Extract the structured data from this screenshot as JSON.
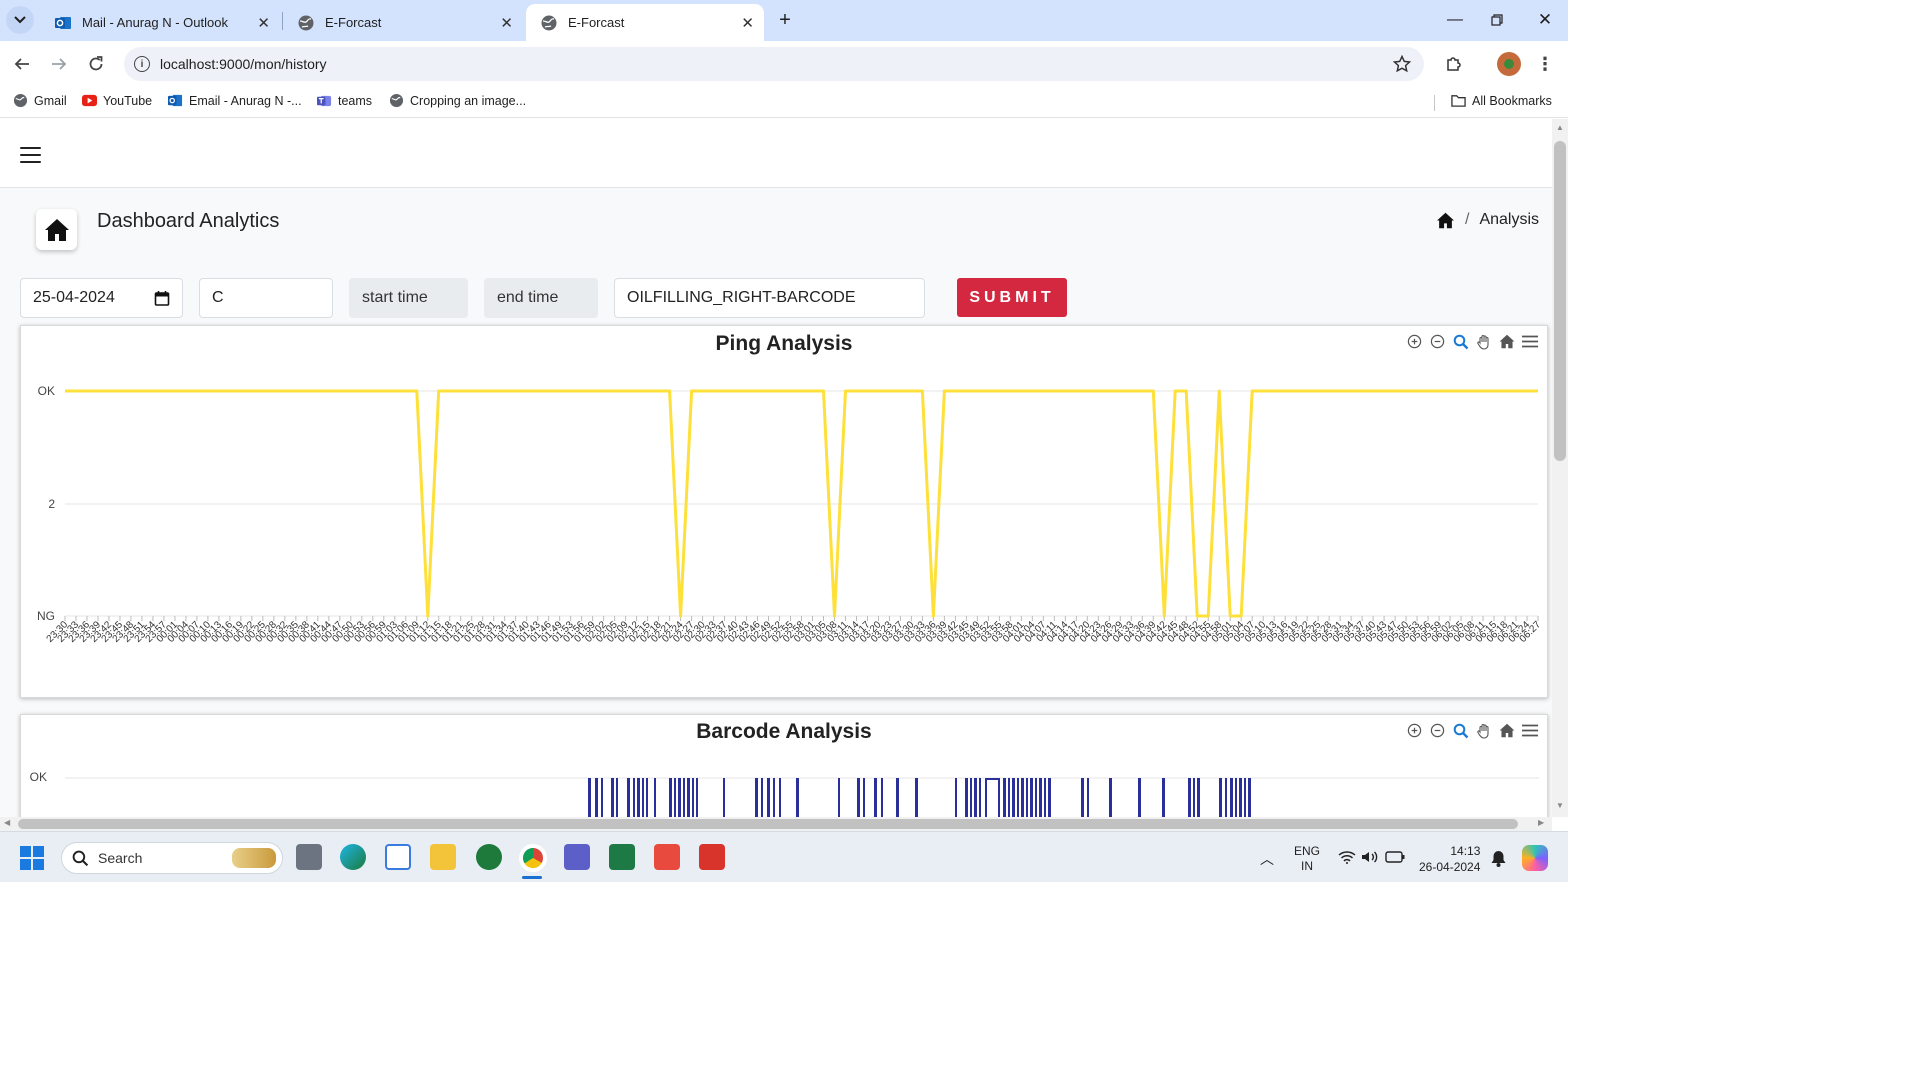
{
  "browser": {
    "tabs": [
      {
        "label": "Mail - Anurag N - Outlook",
        "active": false
      },
      {
        "label": "E-Forcast",
        "active": false
      },
      {
        "label": "E-Forcast",
        "active": true
      }
    ],
    "url": "localhost:9000/mon/history",
    "bookmarks": [
      "Gmail",
      "YouTube",
      "Email - Anurag N -...",
      "teams",
      "Cropping an image..."
    ],
    "all_bookmarks": "All Bookmarks"
  },
  "page": {
    "title": "Dashboard Analytics",
    "breadcrumb": "Analysis",
    "date_value": "25-04-2024",
    "shift_value": "C",
    "start_time_placeholder": "start time",
    "end_time_placeholder": "end time",
    "station_value": "OILFILLING_RIGHT-BARCODE",
    "submit_label": "SUBMIT"
  },
  "chart_data": [
    {
      "type": "line",
      "title": "Ping Analysis",
      "y_ticks": [
        "OK",
        "2",
        "NG"
      ],
      "color": "#fde03a",
      "x": [
        "23:30",
        "23:33",
        "23:36",
        "23:39",
        "23:42",
        "23:45",
        "23:48",
        "23:51",
        "23:54",
        "23:57",
        "00:01",
        "00:04",
        "00:07",
        "00:10",
        "00:13",
        "00:16",
        "00:19",
        "00:22",
        "00:25",
        "00:28",
        "00:32",
        "00:35",
        "00:38",
        "00:41",
        "00:44",
        "00:47",
        "00:50",
        "00:53",
        "00:56",
        "00:59",
        "01:03",
        "01:06",
        "01:09",
        "01:12",
        "01:15",
        "01:18",
        "01:21",
        "01:25",
        "01:28",
        "01:31",
        "01:34",
        "01:37",
        "01:40",
        "01:43",
        "01:46",
        "01:49",
        "01:53",
        "01:56",
        "01:59",
        "02:02",
        "02:05",
        "02:09",
        "02:12",
        "02:15",
        "02:18",
        "02:21",
        "02:24",
        "02:27",
        "02:30",
        "02:33",
        "02:37",
        "02:40",
        "02:43",
        "02:46",
        "02:49",
        "02:52",
        "02:55",
        "02:58",
        "03:01",
        "03:05",
        "03:08",
        "03:11",
        "03:14",
        "03:17",
        "03:20",
        "03:23",
        "03:27",
        "03:30",
        "03:33",
        "03:36",
        "03:39",
        "03:42",
        "03:45",
        "03:49",
        "03:52",
        "03:55",
        "03:58",
        "04:01",
        "04:04",
        "04:07",
        "04:11",
        "04:14",
        "04:17",
        "04:20",
        "04:23",
        "04:26",
        "04:29",
        "04:33",
        "04:36",
        "04:39",
        "04:42",
        "04:45",
        "04:48",
        "04:52",
        "04:55",
        "04:58",
        "05:01",
        "05:04",
        "05:07",
        "05:10",
        "05:13",
        "05:16",
        "05:19",
        "05:22",
        "05:25",
        "05:28",
        "05:31",
        "05:34",
        "05:37",
        "05:40",
        "05:43",
        "05:47",
        "05:50",
        "05:53",
        "05:56",
        "05:59",
        "06:02",
        "06:05",
        "06:08",
        "06:11",
        "06:15",
        "06:18",
        "06:21",
        "06:24",
        "06:27"
      ],
      "values": [
        1,
        1,
        1,
        1,
        1,
        1,
        1,
        1,
        1,
        1,
        1,
        1,
        1,
        1,
        1,
        1,
        1,
        1,
        1,
        1,
        1,
        1,
        1,
        1,
        1,
        1,
        1,
        1,
        1,
        1,
        1,
        1,
        1,
        0,
        1,
        1,
        1,
        1,
        1,
        1,
        1,
        1,
        1,
        1,
        1,
        1,
        1,
        1,
        1,
        1,
        1,
        1,
        1,
        1,
        1,
        1,
        0,
        1,
        1,
        1,
        1,
        1,
        1,
        1,
        1,
        1,
        1,
        1,
        1,
        1,
        0,
        1,
        1,
        1,
        1,
        1,
        1,
        1,
        1,
        0,
        1,
        1,
        1,
        1,
        1,
        1,
        1,
        1,
        1,
        1,
        1,
        1,
        1,
        1,
        1,
        1,
        1,
        1,
        1,
        1,
        0,
        1,
        1,
        0,
        0,
        1,
        0,
        0,
        1,
        1,
        1,
        1,
        1,
        1,
        1,
        1,
        1,
        1,
        1,
        1,
        1,
        1,
        1,
        1,
        1,
        1,
        1,
        1,
        1,
        1,
        1,
        1,
        1,
        1,
        1
      ]
    },
    {
      "type": "line",
      "title": "Barcode Analysis",
      "y_ticks": [
        "OK"
      ],
      "color": "#2a2f9a",
      "x": [],
      "values": []
    }
  ],
  "taskbar": {
    "search_placeholder": "Search",
    "lang_line1": "ENG",
    "lang_line2": "IN",
    "time": "14:13",
    "date": "26-04-2024"
  }
}
